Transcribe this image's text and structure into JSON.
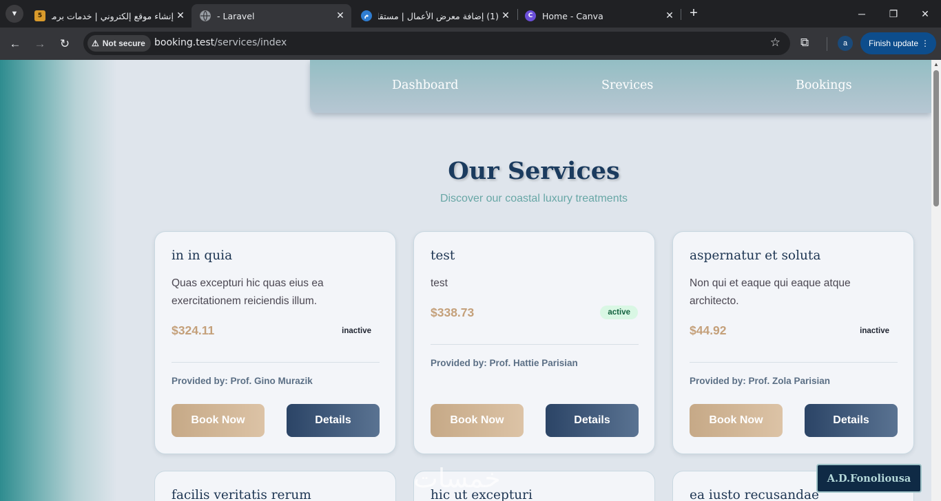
{
  "browser": {
    "tabs": [
      {
        "title": "إنشاء موقع إلكتروني | خدمات برمجة",
        "favicon": "5"
      },
      {
        "title": "- Laravel",
        "favicon": "globe-icon"
      },
      {
        "title": "(1) إضافة معرض الأعمال | مستقل",
        "favicon": "mostaql-icon"
      },
      {
        "title": "Home - Canva",
        "favicon": "canva-icon"
      }
    ],
    "security_label": "Not secure",
    "url_host": "booking.test",
    "url_path": "/services/index",
    "profile_initial": "a",
    "update_label": "Finish update"
  },
  "nav": {
    "items": [
      "Dashboard",
      "Srevices",
      "Bookings"
    ]
  },
  "page": {
    "title": "Our Services",
    "subtitle": "Discover our coastal luxury treatments"
  },
  "services": [
    {
      "name": "in in quia",
      "description": "Quas excepturi hic quas eius ea exercitationem reiciendis illum.",
      "price": "$324.11",
      "status": "inactive",
      "provider": "Provided by: Prof. Gino Murazik"
    },
    {
      "name": "test",
      "description": "test",
      "price": "$338.73",
      "status": "active",
      "provider": "Provided by: Prof. Hattie Parisian"
    },
    {
      "name": "aspernatur et soluta",
      "description": "Non qui et eaque qui eaque atque architecto.",
      "price": "$44.92",
      "status": "inactive",
      "provider": "Provided by: Prof. Zola Parisian"
    },
    {
      "name": "facilis veritatis rerum"
    },
    {
      "name": "hic ut excepturi"
    },
    {
      "name": "ea iusto recusandae"
    }
  ],
  "buttons": {
    "book": "Book Now",
    "details": "Details"
  },
  "overlay": {
    "watermark": "خمسات",
    "signature": "A.D.Fonoliousa"
  },
  "colors": {
    "heading": "#1b3b5e",
    "subtitle": "#68a7a6",
    "price": "#c4a07a",
    "book_button": "#c6a987",
    "details_button": "#2b4466"
  }
}
